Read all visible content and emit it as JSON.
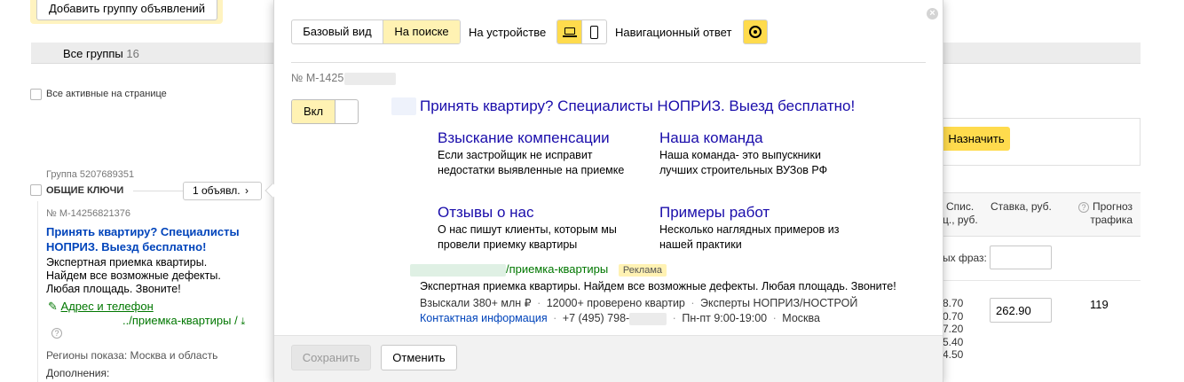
{
  "bg": {
    "add_group_button": "Добавить группу объявлений",
    "tab_all_groups_label": "Все группы",
    "tab_all_groups_count": "16",
    "select_all_active": "Все активные на странице",
    "assign_button": "Назначить",
    "group_label": "Группа 5207689351",
    "group_name": "ОБЩИЕ КЛЮЧИ",
    "ads_count_button": "1 объявл.",
    "ad_number": "№ М-14256821376",
    "ad_title": "Принять квартиру? Специалисты НОПРИЗ. Выезд бесплатно!",
    "ad_text": "Экспертная приемка квартиры. Найдем все возможные дефекты. Любая площадь. Звоните!",
    "address_phone_link": "Адрес и телефон",
    "display_url": "../приемка-квартиры /",
    "help_mark": "?",
    "regions": "Регионы показа: Москва и область",
    "additions": "Дополнения:",
    "col_spis_line1": "Спис.",
    "col_spis_line2": "ц., руб.",
    "col_bid": "Ставка, руб.",
    "col_forecast_line1": "Прогноз",
    "col_forecast_line2": "трафика",
    "phrases_label": "ых фраз:",
    "bid_input_value": "262.90",
    "forecast_value": "119",
    "spis_values": [
      "8.70",
      "0.70",
      "7.20",
      "5.40",
      "4.50"
    ]
  },
  "popup": {
    "view_tabs": [
      "Базовый вид",
      "На поиске"
    ],
    "active_tab": "На поиске",
    "device_label": "На устройстве",
    "device_icons": [
      "laptop-icon",
      "phone-icon"
    ],
    "nav_answer_label": "Навигационный ответ",
    "nav_icon": "target-icon",
    "ad_number_prefix": "№ М-1425",
    "toggle_label": "Вкл",
    "preview": {
      "title": "Принять квартиру? Специалисты НОПРИЗ. Выезд бесплатно!",
      "sitelinks": [
        {
          "title": "Взыскание компенсации",
          "desc": "Если застройщик не исправит недостатки выявленные на приемке"
        },
        {
          "title": "Наша команда",
          "desc": "Наша команда- это выпускники лучших строительных ВУЗов РФ"
        },
        {
          "title": "Отзывы о нас",
          "desc": "О нас пишут клиенты, которым мы провели приемку квартиры"
        },
        {
          "title": "Примеры работ",
          "desc": "Несколько наглядных примеров из нашей практики"
        }
      ],
      "url_path": "/приемка-квартиры",
      "ad_badge": "Реклама",
      "text": "Экспертная приемка квартиры. Найдем все возможные дефекты. Любая площадь. Звоните!",
      "callouts": [
        "Взыскали 380+ млн ₽",
        "12000+ проверено квартир",
        "Эксперты НОПРИЗ/НОСТРОЙ"
      ],
      "contact_link": "Контактная информация",
      "phone_prefix": "+7 (495) 798-",
      "hours": "Пн-пт 9:00-19:00",
      "city": "Москва",
      "dot": "·"
    },
    "save_button": "Сохранить",
    "cancel_button": "Отменить",
    "close_icon": "close-icon"
  },
  "colors": {
    "accent_yellow": "#ffdb4d",
    "active_tab_bg": "#fff2b3",
    "link_blue": "#0044bb",
    "preview_title_blue": "#1a0dab",
    "green_url": "#007700"
  }
}
